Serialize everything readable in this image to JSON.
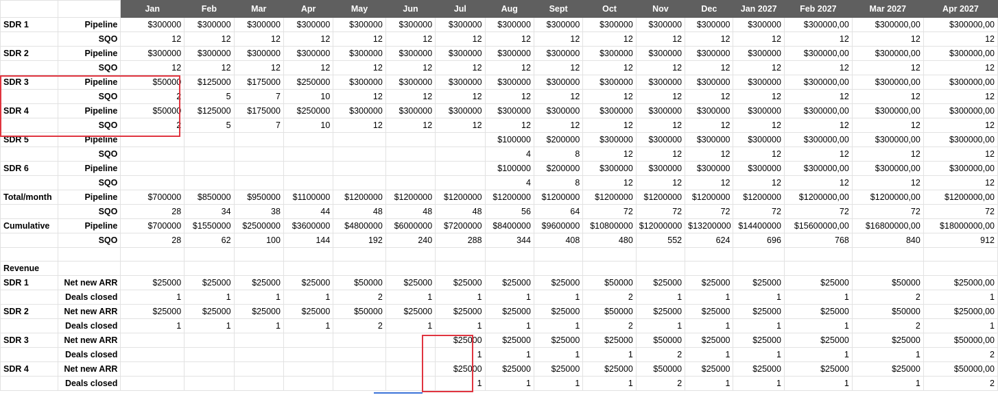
{
  "months": [
    "Jan",
    "Feb",
    "Mar",
    "Apr",
    "May",
    "Jun",
    "Jul",
    "Aug",
    "Sept",
    "Oct",
    "Nov",
    "Dec",
    "Jan 2027",
    "Feb 2027",
    "Mar 2027",
    "Apr 2027"
  ],
  "rows": [
    {
      "label": "SDR 1",
      "metric": "Pipeline",
      "values": [
        "$300000",
        "$300000",
        "$300000",
        "$300000",
        "$300000",
        "$300000",
        "$300000",
        "$300000",
        "$300000",
        "$300000",
        "$300000",
        "$300000",
        "$300000",
        "$300000,00",
        "$300000,00",
        "$300000,00"
      ]
    },
    {
      "label": "",
      "metric": "SQO",
      "values": [
        "12",
        "12",
        "12",
        "12",
        "12",
        "12",
        "12",
        "12",
        "12",
        "12",
        "12",
        "12",
        "12",
        "12",
        "12",
        "12"
      ]
    },
    {
      "label": "SDR 2",
      "metric": "Pipeline",
      "values": [
        "$300000",
        "$300000",
        "$300000",
        "$300000",
        "$300000",
        "$300000",
        "$300000",
        "$300000",
        "$300000",
        "$300000",
        "$300000",
        "$300000",
        "$300000",
        "$300000,00",
        "$300000,00",
        "$300000,00"
      ]
    },
    {
      "label": "",
      "metric": "SQO",
      "values": [
        "12",
        "12",
        "12",
        "12",
        "12",
        "12",
        "12",
        "12",
        "12",
        "12",
        "12",
        "12",
        "12",
        "12",
        "12",
        "12"
      ]
    },
    {
      "label": "SDR 3",
      "metric": "Pipeline",
      "values": [
        "$50000",
        "$125000",
        "$175000",
        "$250000",
        "$300000",
        "$300000",
        "$300000",
        "$300000",
        "$300000",
        "$300000",
        "$300000",
        "$300000",
        "$300000",
        "$300000,00",
        "$300000,00",
        "$300000,00"
      ]
    },
    {
      "label": "",
      "metric": "SQO",
      "values": [
        "2",
        "5",
        "7",
        "10",
        "12",
        "12",
        "12",
        "12",
        "12",
        "12",
        "12",
        "12",
        "12",
        "12",
        "12",
        "12"
      ]
    },
    {
      "label": "SDR 4",
      "metric": "Pipeline",
      "values": [
        "$50000",
        "$125000",
        "$175000",
        "$250000",
        "$300000",
        "$300000",
        "$300000",
        "$300000",
        "$300000",
        "$300000",
        "$300000",
        "$300000",
        "$300000",
        "$300000,00",
        "$300000,00",
        "$300000,00"
      ]
    },
    {
      "label": "",
      "metric": "SQO",
      "values": [
        "2",
        "5",
        "7",
        "10",
        "12",
        "12",
        "12",
        "12",
        "12",
        "12",
        "12",
        "12",
        "12",
        "12",
        "12",
        "12"
      ]
    },
    {
      "label": "SDR 5",
      "metric": "Pipeline",
      "values": [
        "",
        "",
        "",
        "",
        "",
        "",
        "",
        "$100000",
        "$200000",
        "$300000",
        "$300000",
        "$300000",
        "$300000",
        "$300000,00",
        "$300000,00",
        "$300000,00"
      ]
    },
    {
      "label": "",
      "metric": "SQO",
      "values": [
        "",
        "",
        "",
        "",
        "",
        "",
        "",
        "4",
        "8",
        "12",
        "12",
        "12",
        "12",
        "12",
        "12",
        "12"
      ]
    },
    {
      "label": "SDR 6",
      "metric": "Pipeline",
      "values": [
        "",
        "",
        "",
        "",
        "",
        "",
        "",
        "$100000",
        "$200000",
        "$300000",
        "$300000",
        "$300000",
        "$300000",
        "$300000,00",
        "$300000,00",
        "$300000,00"
      ]
    },
    {
      "label": "",
      "metric": "SQO",
      "values": [
        "",
        "",
        "",
        "",
        "",
        "",
        "",
        "4",
        "8",
        "12",
        "12",
        "12",
        "12",
        "12",
        "12",
        "12"
      ]
    },
    {
      "label": "Total/month",
      "metric": "Pipeline",
      "values": [
        "$700000",
        "$850000",
        "$950000",
        "$1100000",
        "$1200000",
        "$1200000",
        "$1200000",
        "$1200000",
        "$1200000",
        "$1200000",
        "$1200000",
        "$1200000",
        "$1200000",
        "$1200000,00",
        "$1200000,00",
        "$1200000,00"
      ]
    },
    {
      "label": "",
      "metric": "SQO",
      "values": [
        "28",
        "34",
        "38",
        "44",
        "48",
        "48",
        "48",
        "56",
        "64",
        "72",
        "72",
        "72",
        "72",
        "72",
        "72",
        "72"
      ]
    },
    {
      "label": "Cumulative",
      "metric": "Pipeline",
      "values": [
        "$700000",
        "$1550000",
        "$2500000",
        "$3600000",
        "$4800000",
        "$6000000",
        "$7200000",
        "$8400000",
        "$9600000",
        "$10800000",
        "$12000000",
        "$13200000",
        "$14400000",
        "$15600000,00",
        "$16800000,00",
        "$18000000,00"
      ]
    },
    {
      "label": "",
      "metric": "SQO",
      "values": [
        "28",
        "62",
        "100",
        "144",
        "192",
        "240",
        "288",
        "344",
        "408",
        "480",
        "552",
        "624",
        "696",
        "768",
        "840",
        "912"
      ]
    },
    {
      "label": "",
      "metric": "",
      "values": [
        "",
        "",
        "",
        "",
        "",
        "",
        "",
        "",
        "",
        "",
        "",
        "",
        "",
        "",
        "",
        ""
      ]
    },
    {
      "label": "Revenue",
      "metric": "",
      "values": [
        "",
        "",
        "",
        "",
        "",
        "",
        "",
        "",
        "",
        "",
        "",
        "",
        "",
        "",
        "",
        ""
      ],
      "rev": true
    },
    {
      "label": "SDR 1",
      "metric": "Net new ARR",
      "values": [
        "$25000",
        "$25000",
        "$25000",
        "$25000",
        "$50000",
        "$25000",
        "$25000",
        "$25000",
        "$25000",
        "$50000",
        "$25000",
        "$25000",
        "$25000",
        "$25000",
        "$50000",
        "$25000,00"
      ]
    },
    {
      "label": "",
      "metric": "Deals closed",
      "values": [
        "1",
        "1",
        "1",
        "1",
        "2",
        "1",
        "1",
        "1",
        "1",
        "2",
        "1",
        "1",
        "1",
        "1",
        "2",
        "1"
      ]
    },
    {
      "label": "SDR 2",
      "metric": "Net new ARR",
      "values": [
        "$25000",
        "$25000",
        "$25000",
        "$25000",
        "$50000",
        "$25000",
        "$25000",
        "$25000",
        "$25000",
        "$50000",
        "$25000",
        "$25000",
        "$25000",
        "$25000",
        "$50000",
        "$25000,00"
      ]
    },
    {
      "label": "",
      "metric": "Deals closed",
      "values": [
        "1",
        "1",
        "1",
        "1",
        "2",
        "1",
        "1",
        "1",
        "1",
        "2",
        "1",
        "1",
        "1",
        "1",
        "2",
        "1"
      ]
    },
    {
      "label": "SDR 3",
      "metric": "Net new ARR",
      "values": [
        "",
        "",
        "",
        "",
        "",
        "",
        "$25000",
        "$25000",
        "$25000",
        "$25000",
        "$50000",
        "$25000",
        "$25000",
        "$25000",
        "$25000",
        "$50000,00"
      ]
    },
    {
      "label": "",
      "metric": "Deals closed",
      "values": [
        "",
        "",
        "",
        "",
        "",
        "",
        "1",
        "1",
        "1",
        "1",
        "2",
        "1",
        "1",
        "1",
        "1",
        "2"
      ]
    },
    {
      "label": "SDR 4",
      "metric": "Net new ARR",
      "values": [
        "",
        "",
        "",
        "",
        "",
        "",
        "$25000",
        "$25000",
        "$25000",
        "$25000",
        "$50000",
        "$25000",
        "$25000",
        "$25000",
        "$25000",
        "$50000,00"
      ]
    },
    {
      "label": "",
      "metric": "Deals closed",
      "values": [
        "",
        "",
        "",
        "",
        "",
        "",
        "1",
        "1",
        "1",
        "1",
        "2",
        "1",
        "1",
        "1",
        "1",
        "2"
      ]
    }
  ],
  "colors": {
    "header_bg": "#5f5f5f",
    "highlight": "#e0343f",
    "selection": "#3a72d8"
  }
}
